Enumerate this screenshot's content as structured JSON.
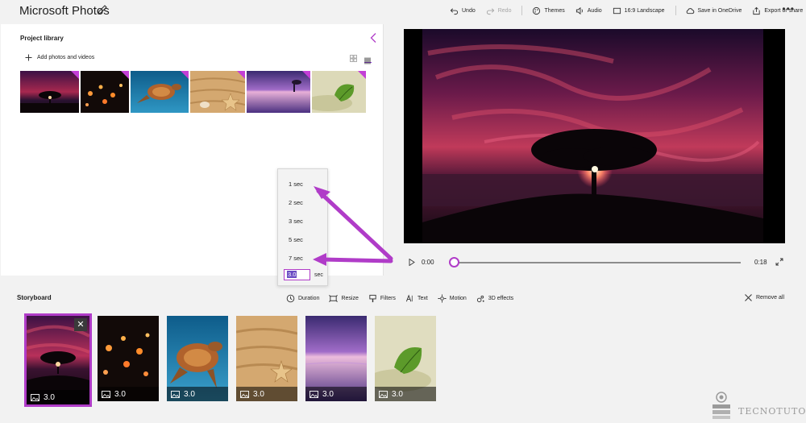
{
  "app": {
    "title": "Microsoft Photos"
  },
  "toolbar": {
    "items": [
      {
        "label": "Undo",
        "icon": "undo-icon",
        "enabled": true
      },
      {
        "label": "Redo",
        "icon": "redo-icon",
        "enabled": false
      },
      {
        "label": "Themes",
        "icon": "themes-icon",
        "enabled": true
      },
      {
        "label": "Audio",
        "icon": "audio-icon",
        "enabled": true
      },
      {
        "label": "16:9 Landscape",
        "icon": "aspect-ratio-icon",
        "enabled": true
      },
      {
        "label": "Save in OneDrive",
        "icon": "cloud-icon",
        "enabled": true
      },
      {
        "label": "Export or share",
        "icon": "export-icon",
        "enabled": true
      }
    ],
    "more": "•••"
  },
  "library": {
    "title": "Project library",
    "add_label": "Add photos and videos",
    "thumbnails": [
      "tree-sunset",
      "candles",
      "sea-turtle",
      "sand-starfish",
      "purple-sea",
      "green-leaf"
    ]
  },
  "duration_menu": {
    "options": [
      "1 sec",
      "2 sec",
      "3 sec",
      "5 sec",
      "7 sec"
    ],
    "custom_value": "3.0",
    "unit": "sec"
  },
  "playback": {
    "current_time": "0:00",
    "total_time": "0:18",
    "progress": 0.0
  },
  "storyboard": {
    "title": "Storyboard",
    "tools": [
      {
        "label": "Duration",
        "icon": "clock-icon"
      },
      {
        "label": "Resize",
        "icon": "resize-icon"
      },
      {
        "label": "Filters",
        "icon": "filters-icon"
      },
      {
        "label": "Text",
        "icon": "text-icon"
      },
      {
        "label": "Motion",
        "icon": "motion-icon"
      },
      {
        "label": "3D effects",
        "icon": "3d-effects-icon"
      }
    ],
    "remove_all": "Remove all",
    "clips": [
      {
        "image": "tree-sunset",
        "duration": "3.0",
        "selected": true
      },
      {
        "image": "candles",
        "duration": "3.0",
        "selected": false
      },
      {
        "image": "sea-turtle",
        "duration": "3.0",
        "selected": false
      },
      {
        "image": "sand-starfish",
        "duration": "3.0",
        "selected": false
      },
      {
        "image": "purple-sea",
        "duration": "3.0",
        "selected": false
      },
      {
        "image": "green-leaf",
        "duration": "3.0",
        "selected": false
      }
    ]
  },
  "watermark": {
    "text": "TECNOTUTO"
  },
  "colors": {
    "accent": "#b03cc8",
    "arrow": "#b03cc8"
  }
}
